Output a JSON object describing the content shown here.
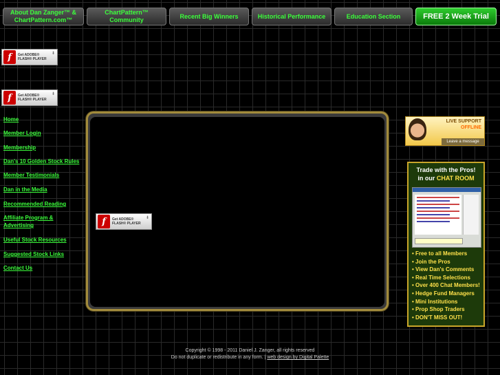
{
  "nav": {
    "tabs": [
      {
        "label": "About Dan Zanger™ & ChartPattern.com™"
      },
      {
        "label": "ChartPattern™ Community"
      },
      {
        "label": "Recent Big Winners"
      },
      {
        "label": "Historical Performance"
      },
      {
        "label": "Education Section"
      },
      {
        "label": "FREE 2 Week Trial"
      }
    ]
  },
  "flash": {
    "line1": "Get ADOBE®",
    "line2": "FLASH® PLAYER"
  },
  "sidebar": {
    "items": [
      {
        "label": "Home"
      },
      {
        "label": "Member Login"
      },
      {
        "label": "Membership"
      },
      {
        "label": "Dan's 10 Golden Stock Rules"
      },
      {
        "label": "Member Testimonials"
      },
      {
        "label": "Dan in the Media"
      },
      {
        "label": "Recommended Reading"
      },
      {
        "label": "Affiliate Program & Advertising"
      },
      {
        "label": "Useful Stock Resources"
      },
      {
        "label": "Suggested Stock Links"
      },
      {
        "label": "Contact Us"
      }
    ]
  },
  "live_support": {
    "title": "LIVE SUPPORT",
    "status": "OFFLINE",
    "action": "Leave a message"
  },
  "chat_ad": {
    "heading_line1": "Trade with the Pros!",
    "heading_line2_prefix": "in our ",
    "heading_line2_highlight": "CHAT ROOM",
    "bullets": [
      "Free to all Members",
      "Join the Pros",
      "View Dan's Comments",
      "Real Time Selections",
      "Over 400 Chat Members!",
      "Hedge Fund Managers",
      "Mini Institutions",
      "Prop Shop Traders",
      "DON'T MISS OUT!"
    ]
  },
  "footer": {
    "copyright": "Copyright © 1998 - 2011 Daniel J. Zanger, all rights reserved",
    "notice": "Do not duplicate or redistribute in any form. |",
    "credit_link": "web design by Digital Palette"
  }
}
